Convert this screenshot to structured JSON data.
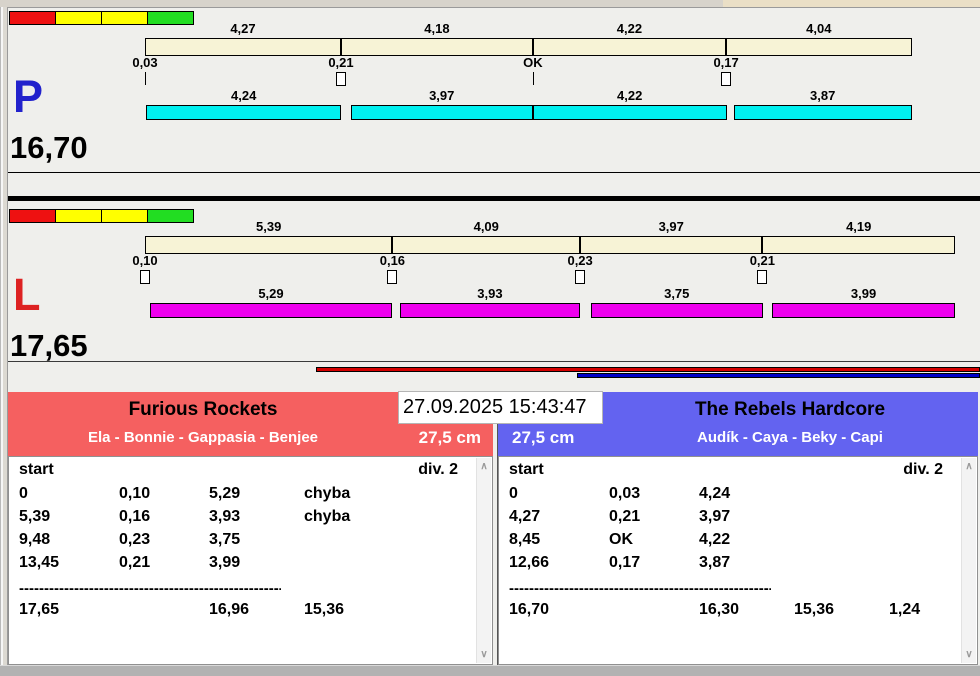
{
  "datetime": "27.09.2025 15:43:47",
  "colors": {
    "split_bar": "#f7f3d6",
    "marker_box": "#ffffff",
    "progress_red": "#d40000",
    "progress_blue": "#0000c8"
  },
  "scrollbar": {
    "up": "∧",
    "down": "∨"
  },
  "lanes": [
    {
      "letter": "P",
      "letter_color": "#2222cc",
      "total": "16,70",
      "bar_color": "#00f0f0",
      "lights": [
        "#ee1111",
        "#ffff00",
        "#ffff00",
        "#22dd22"
      ],
      "legs": [
        {
          "start": 0,
          "end": 4.27,
          "split": "4,27",
          "gap": 0.03,
          "gap_label": "0,03",
          "marker": "tick",
          "dog": 4.24,
          "dog_label": "4,24"
        },
        {
          "start": 4.27,
          "end": 8.45,
          "split": "4,18",
          "gap": 0.21,
          "gap_label": "0,21",
          "marker": "box",
          "dog": 3.97,
          "dog_label": "3,97"
        },
        {
          "start": 8.45,
          "end": 12.66,
          "split": "4,22",
          "gap": 0,
          "gap_label": "OK",
          "marker": "tick",
          "dog": 4.22,
          "dog_label": "4,22"
        },
        {
          "start": 12.66,
          "end": 16.7,
          "split": "4,04",
          "gap": 0.17,
          "gap_label": "0,17",
          "marker": "box",
          "dog": 3.87,
          "dog_label": "3,87"
        }
      ]
    },
    {
      "letter": "L",
      "letter_color": "#dd2222",
      "total": "17,65",
      "bar_color": "#ee00ee",
      "lights": [
        "#ee1111",
        "#ffff00",
        "#ffff00",
        "#22dd22"
      ],
      "legs": [
        {
          "start": 0,
          "end": 5.39,
          "split": "5,39",
          "gap": 0.1,
          "gap_label": "0,10",
          "marker": "box",
          "dog": 5.29,
          "dog_label": "5,29"
        },
        {
          "start": 5.39,
          "end": 9.48,
          "split": "4,09",
          "gap": 0.16,
          "gap_label": "0,16",
          "marker": "box",
          "dog": 3.93,
          "dog_label": "3,93"
        },
        {
          "start": 9.48,
          "end": 13.45,
          "split": "3,97",
          "gap": 0.23,
          "gap_label": "0,23",
          "marker": "box",
          "dog": 3.75,
          "dog_label": "3,75"
        },
        {
          "start": 13.45,
          "end": 17.65,
          "split": "4,19",
          "gap": 0.21,
          "gap_label": "0,21",
          "marker": "box",
          "dog": 3.99,
          "dog_label": "3,99"
        }
      ]
    }
  ],
  "teams": [
    {
      "name": "Furious Rockets",
      "members": "Ela - Bonnie - Gappasia - Benjee",
      "height": "27,5 cm",
      "header_color": "#f56060",
      "table": {
        "header_left": "start",
        "header_right": "div. 2",
        "rows": [
          [
            "0",
            "0,10",
            "5,29",
            "chyba",
            ""
          ],
          [
            "5,39",
            "0,16",
            "3,93",
            "chyba",
            ""
          ],
          [
            "9,48",
            "0,23",
            "3,75",
            "",
            ""
          ],
          [
            "13,45",
            "0,21",
            "3,99",
            "",
            ""
          ]
        ],
        "separator": "------------------------------------------------------------",
        "totals": [
          "17,65",
          "",
          "16,96",
          "15,36",
          ""
        ]
      }
    },
    {
      "name": "The Rebels Hardcore",
      "members": "Audík - Caya - Beky - Capi",
      "height": "27,5 cm",
      "header_color": "#6363f0",
      "table": {
        "header_left": "start",
        "header_right": "div. 2",
        "rows": [
          [
            "0",
            "0,03",
            "4,24",
            "",
            ""
          ],
          [
            "4,27",
            "0,21",
            "3,97",
            "",
            ""
          ],
          [
            "8,45",
            "OK",
            "4,22",
            "",
            ""
          ],
          [
            "12,66",
            "0,17",
            "3,87",
            "",
            ""
          ]
        ],
        "separator": "------------------------------------------------------------",
        "totals": [
          "16,70",
          "",
          "16,30",
          "15,36",
          "1,24"
        ]
      }
    }
  ]
}
